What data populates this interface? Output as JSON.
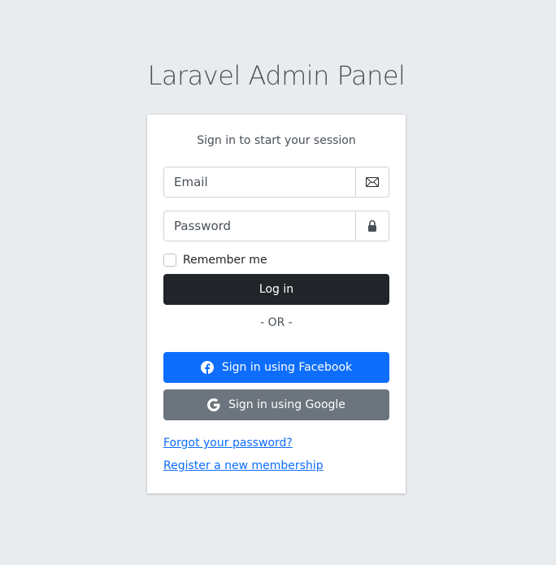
{
  "header": {
    "title": "Laravel Admin Panel"
  },
  "card": {
    "message": "Sign in to start your session",
    "email": {
      "placeholder": "Email",
      "value": ""
    },
    "password": {
      "placeholder": "Password",
      "value": ""
    },
    "remember_label": "Remember me",
    "login_label": "Log in",
    "or_text": "- OR -",
    "facebook_label": "Sign in using Facebook",
    "google_label": "Sign in using Google",
    "forgot_link": "Forgot your password?",
    "register_link": "Register a new membership"
  },
  "icons": {
    "email": "envelope-icon",
    "password": "lock-icon",
    "facebook": "facebook-icon",
    "google": "google-icon"
  },
  "colors": {
    "background": "#e9ecef",
    "login_button": "#212529",
    "facebook_button": "#0d6efd",
    "google_button": "#6c757d",
    "link": "#0d6efd"
  }
}
